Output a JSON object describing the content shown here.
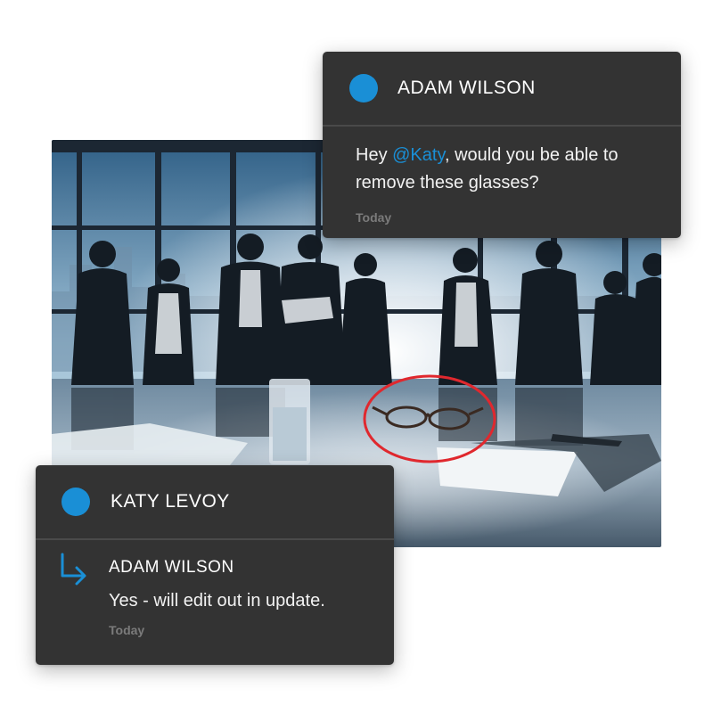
{
  "colors": {
    "accent": "#1a8fd6",
    "card_background": "#333333",
    "highlight_circle": "#e0282e"
  },
  "photo": {
    "subject": "business people silhouetted in a meeting room with glasses on the table"
  },
  "comment_top": {
    "author": "ADAM WILSON",
    "message_before": "Hey ",
    "mention": "@Katy",
    "message_after": ", would you be able to remove these glasses?",
    "timestamp": "Today"
  },
  "comment_bottom": {
    "author": "KATY LEVOY",
    "reply": {
      "icon": "reply-arrow-icon",
      "author": "ADAM WILSON",
      "message": "Yes - will edit out in update.",
      "timestamp": "Today"
    }
  }
}
